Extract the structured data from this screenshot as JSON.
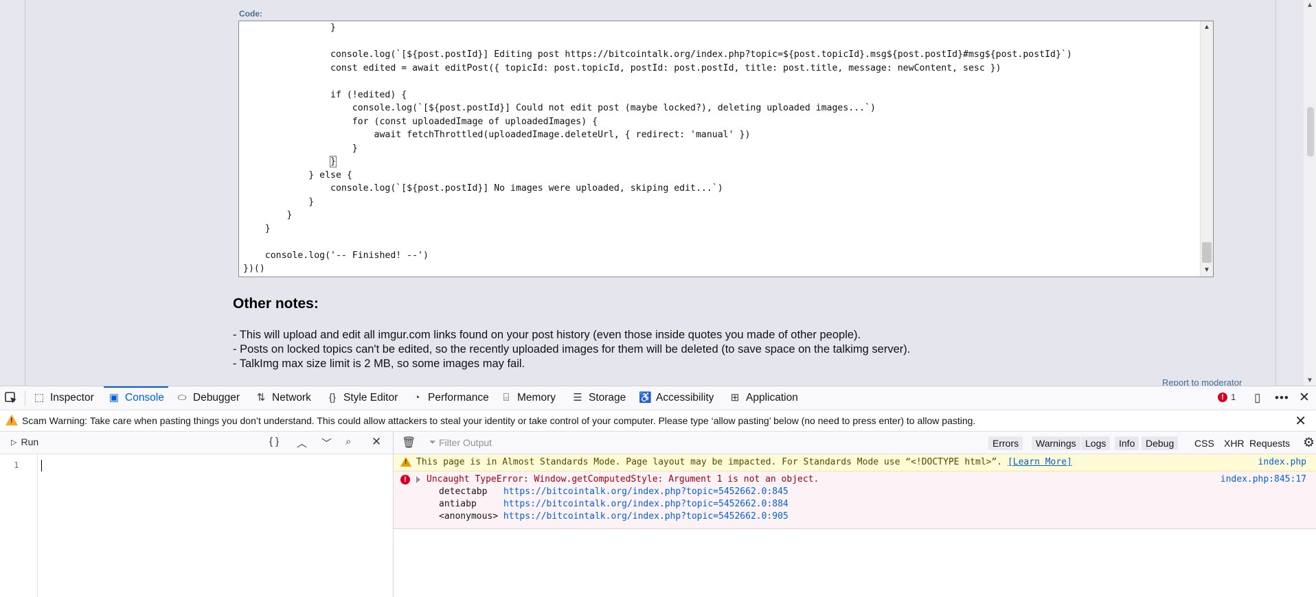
{
  "page": {
    "code_label": "Code:",
    "code_lines": [
      "                }",
      "",
      "                console.log(`[${post.postId}] Editing post https://bitcointalk.org/index.php?topic=${post.topicId}.msg${post.postId}#msg${post.postId}`)",
      "                const edited = await editPost({ topicId: post.topicId, postId: post.postId, title: post.title, message: newContent, sesc })",
      "",
      "                if (!edited) {",
      "                    console.log(`[${post.postId}] Could not edit post (maybe locked?), deleting uploaded images...`)",
      "                    for (const uploadedImage of uploadedImages) {",
      "                        await fetchThrottled(uploadedImage.deleteUrl, { redirect: 'manual' })",
      "                    }",
      "                }",
      "            } else {",
      "                console.log(`[${post.postId}] No images were uploaded, skiping edit...`)",
      "            }",
      "        }",
      "    }",
      "",
      "    console.log('-- Finished! --')",
      "})()"
    ],
    "notes_title": "Other notes:",
    "notes": [
      "- This will upload and edit all imgur.com links found on your post history (even those inside quotes you made of other people).",
      "- Posts on locked topics can't be edited, so the recently uploaded images for them will be deleted (to save space on the talkimg server).",
      "- TalkImg max size limit is 2 MB, so some images may fail."
    ],
    "report_link": "Report to moderator"
  },
  "devtools": {
    "tabs": [
      {
        "label": "Inspector",
        "icon": "inspector-icon"
      },
      {
        "label": "Console",
        "icon": "console-icon",
        "active": true
      },
      {
        "label": "Debugger",
        "icon": "debugger-icon"
      },
      {
        "label": "Network",
        "icon": "network-icon"
      },
      {
        "label": "Style Editor",
        "icon": "style-editor-icon"
      },
      {
        "label": "Performance",
        "icon": "performance-icon"
      },
      {
        "label": "Memory",
        "icon": "memory-icon"
      },
      {
        "label": "Storage",
        "icon": "storage-icon"
      },
      {
        "label": "Accessibility",
        "icon": "accessibility-icon"
      },
      {
        "label": "Application",
        "icon": "application-icon"
      }
    ],
    "error_count": "1",
    "scam_warning": "Scam Warning: Take care when pasting things you don’t understand. This could allow attackers to steal your identity or take control of your computer. Please type ‘allow pasting’ below (no need to press enter) to allow pasting.",
    "editor": {
      "run_label": "Run",
      "line_number": "1"
    },
    "output": {
      "filter_placeholder": "Filter Output",
      "filters": [
        "Errors",
        "Warnings",
        "Logs",
        "Info",
        "Debug"
      ],
      "toggles": [
        "CSS",
        "XHR",
        "Requests"
      ],
      "warning": {
        "text": "This page is in Almost Standards Mode. Page layout may be impacted. For Standards Mode use “<!DOCTYPE html>”.",
        "link": "[Learn More]",
        "source": "index.php"
      },
      "error": {
        "text": "Uncaught TypeError: Window.getComputedStyle: Argument 1 is not an object.",
        "source": "index.php:845:17",
        "frames": [
          {
            "fn": "detectabp",
            "loc": "https://bitcointalk.org/index.php?topic=5452662.0:845"
          },
          {
            "fn": "antiabp",
            "loc": "https://bitcointalk.org/index.php?topic=5452662.0:884"
          },
          {
            "fn": "<anonymous>",
            "loc": "https://bitcointalk.org/index.php?topic=5452662.0:905"
          }
        ]
      }
    },
    "colors": {
      "accent": "#0060df",
      "error": "#d70022",
      "warning_bg": "#fffbd6",
      "error_bg": "#fdf2f5"
    }
  }
}
